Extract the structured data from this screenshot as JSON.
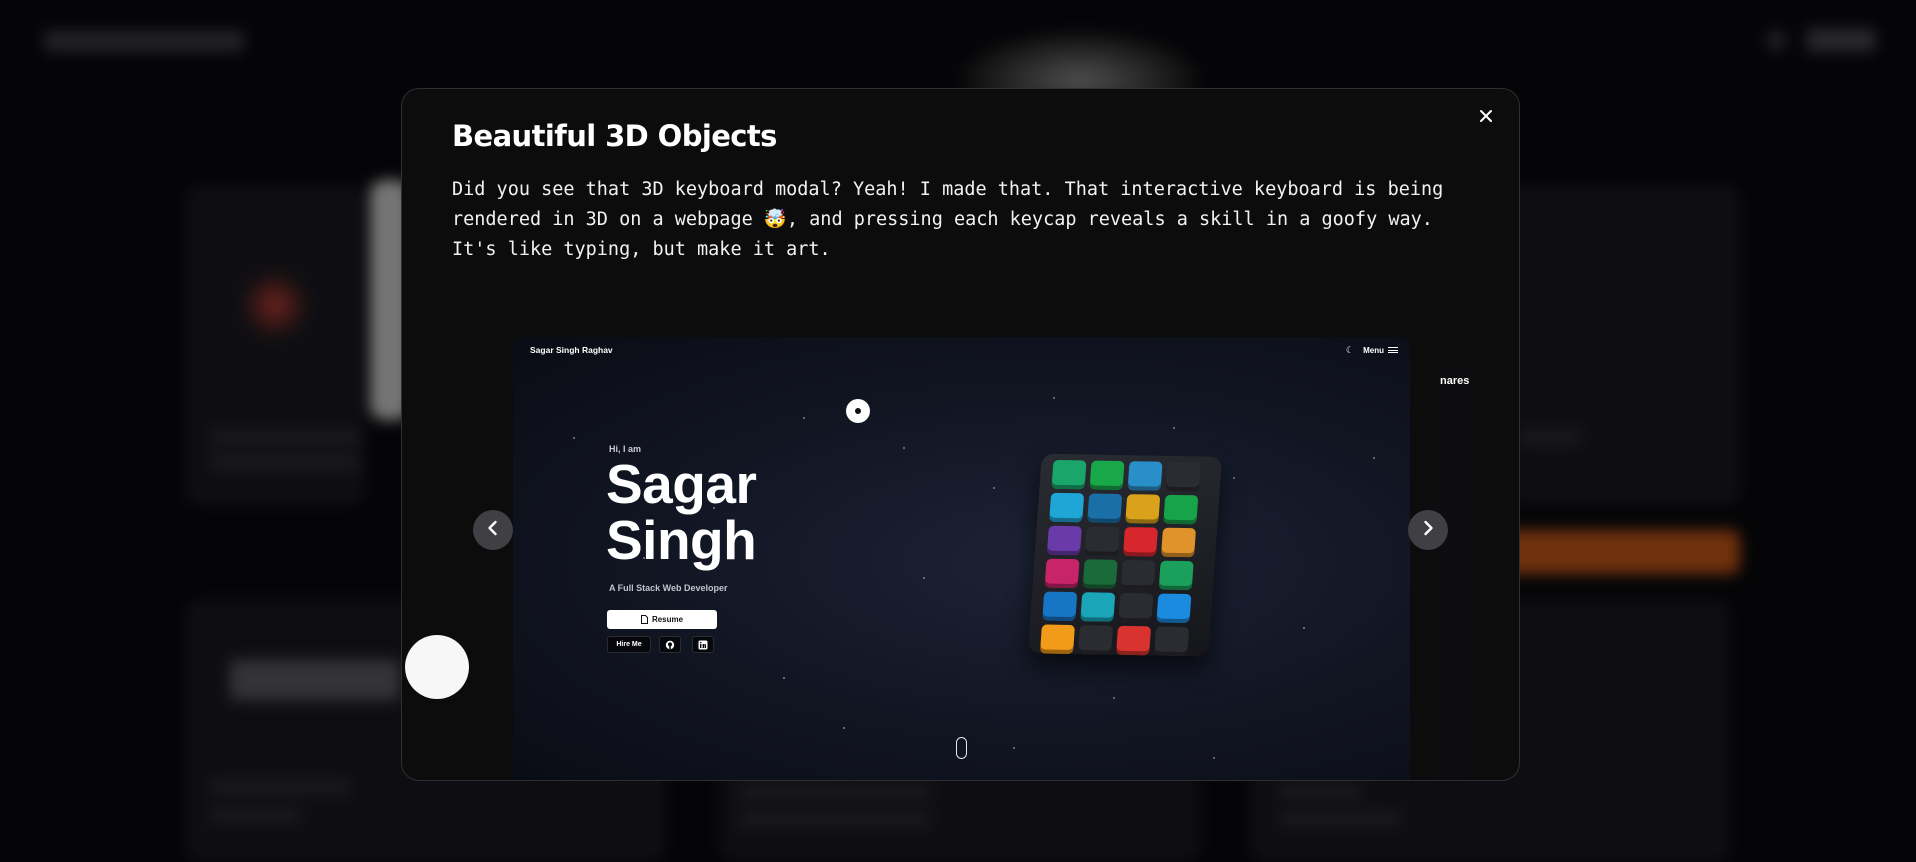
{
  "modal": {
    "title": "Beautiful 3D Objects",
    "description": "Did you see that 3D keyboard modal? Yeah! I made that. That interactive keyboard is being rendered in 3D on a webpage 🤯, and pressing each keycap reveals a skill in a goofy way. It's like typing, but make it art.",
    "close_icon": "close-icon"
  },
  "carousel": {
    "slide": {
      "brand": "Sagar Singh Raghav",
      "menu_label": "Menu",
      "greeting": "Hi, I am",
      "name_line1": "Sagar",
      "name_line2": "Singh",
      "role": "A Full Stack Web Developer",
      "resume_label": "Resume",
      "hire_label": "Hire Me"
    },
    "next_slide_peek": "naresh",
    "prev_icon": "chevron-left-icon",
    "next_icon": "chevron-right-icon"
  },
  "keyboard_keys": [
    {
      "color": "#1aa66b"
    },
    {
      "color": "#18a84a"
    },
    {
      "color": "#2a8fc9"
    },
    {
      "color": "#2b2c32"
    },
    {
      "color": "#1ea7d6"
    },
    {
      "color": "#1b6fa8"
    },
    {
      "color": "#d9a21a"
    },
    {
      "color": "#17a34a"
    },
    {
      "color": "#6a3aa8"
    },
    {
      "color": "#2b2c32"
    },
    {
      "color": "#d8262e"
    },
    {
      "color": "#e0932a"
    },
    {
      "color": "#c8246a"
    },
    {
      "color": "#1b6b3a"
    },
    {
      "color": "#2b2c32"
    },
    {
      "color": "#1aa05a"
    },
    {
      "color": "#1874c4"
    },
    {
      "color": "#1aa6b8"
    },
    {
      "color": "#2b2c32"
    },
    {
      "color": "#1b8be0"
    },
    {
      "color": "#f29a1a"
    },
    {
      "color": "#2b2c32"
    },
    {
      "color": "#d8332e"
    },
    {
      "color": "#2b2c32"
    }
  ]
}
